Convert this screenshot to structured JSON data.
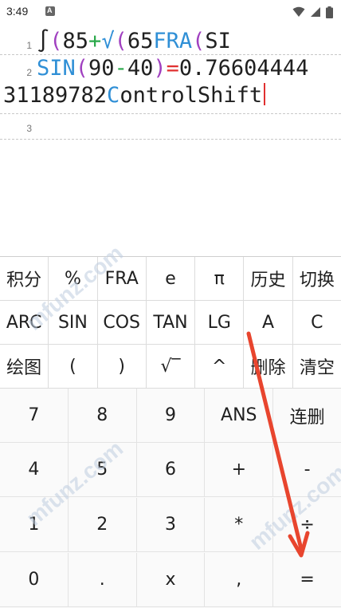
{
  "status_bar": {
    "time": "3:49",
    "notification_letter": "A",
    "icons": [
      "wifi-icon",
      "signal-icon",
      "battery-icon"
    ]
  },
  "editor": {
    "lines": [
      {
        "number": "1",
        "segments": [
          {
            "text": "∫",
            "color": "default"
          },
          {
            "text": "(",
            "color": "purple"
          },
          {
            "text": "85",
            "color": "default"
          },
          {
            "text": "+",
            "color": "green"
          },
          {
            "text": "√",
            "color": "blue"
          },
          {
            "text": "(",
            "color": "purple"
          },
          {
            "text": "65",
            "color": "default"
          },
          {
            "text": "FRA",
            "color": "blue"
          },
          {
            "text": "(",
            "color": "purple"
          },
          {
            "text": "SI",
            "color": "default"
          }
        ]
      },
      {
        "number": "2",
        "segments": [
          {
            "text": "SIN",
            "color": "blue"
          },
          {
            "text": "(",
            "color": "purple"
          },
          {
            "text": "90",
            "color": "default"
          },
          {
            "text": "-",
            "color": "green"
          },
          {
            "text": "40",
            "color": "default"
          },
          {
            "text": ")",
            "color": "purple"
          },
          {
            "text": "=",
            "color": "red"
          },
          {
            "text": "0.76604444",
            "color": "default"
          }
        ]
      },
      {
        "continuation": [
          {
            "text": "31189782",
            "color": "default"
          },
          {
            "text": "C",
            "color": "blue"
          },
          {
            "text": "ontrolShift",
            "color": "default"
          }
        ]
      },
      {
        "number": "3",
        "segments": []
      }
    ]
  },
  "keypad_functions": [
    [
      "积分",
      "%",
      "FRA",
      "e",
      "π",
      "历史",
      "切换"
    ],
    [
      "ARC",
      "SIN",
      "COS",
      "TAN",
      "LG",
      "A",
      "C"
    ],
    [
      "绘图",
      "(",
      ")",
      "√‾",
      "^",
      "删除",
      "清空"
    ]
  ],
  "keypad_numbers": [
    [
      "7",
      "8",
      "9",
      "ANS",
      "连删"
    ],
    [
      "4",
      "5",
      "6",
      "+",
      "-"
    ],
    [
      "1",
      "2",
      "3",
      "*",
      "÷"
    ],
    [
      "0",
      ".",
      "x",
      ",",
      "="
    ]
  ],
  "watermark": "mfunz.com",
  "colors": {
    "blue": "#2f8fd6",
    "purple": "#a040c0",
    "green": "#2aa84a",
    "red": "#e03030",
    "arrow": "#e8452e"
  }
}
